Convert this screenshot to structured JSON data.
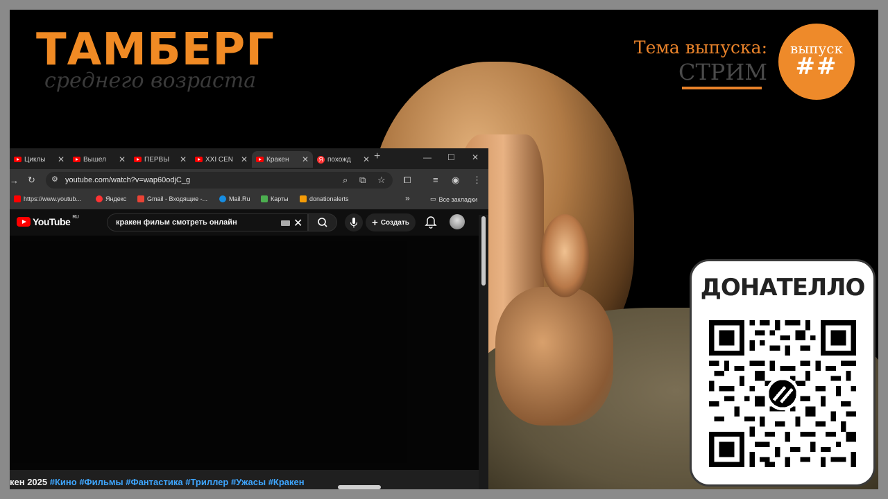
{
  "overlay": {
    "brand_title": "ТАМБЕРГ",
    "brand_subtitle": "среднего возраста",
    "topic_label": "Тема выпуска:",
    "topic_value": "СТРИМ",
    "issue_label": "выпуск",
    "issue_number": "##",
    "donate_title": "ДОНАТЕЛЛО",
    "accent_color": "#f08a24"
  },
  "browser": {
    "tabs": [
      {
        "label": "Циклы",
        "icon": "youtube-icon"
      },
      {
        "label": "Вышел",
        "icon": "youtube-icon"
      },
      {
        "label": "ПЕРВЫ",
        "icon": "youtube-icon"
      },
      {
        "label": "XXI CEN",
        "icon": "youtube-icon"
      },
      {
        "label": "Кракен",
        "icon": "youtube-icon",
        "active": true
      },
      {
        "label": "похожд",
        "icon": "yandex-icon"
      }
    ],
    "url": "youtube.com/watch?v=wap60odjC_g",
    "bookmarks": [
      {
        "label": "https://www.youtub...",
        "icon": "youtube-icon"
      },
      {
        "label": "Яндекс",
        "icon": "yandex-icon"
      },
      {
        "label": "Gmail - Входящие -...",
        "icon": "gmail-icon"
      },
      {
        "label": "Mail.Ru",
        "icon": "mailru-icon"
      },
      {
        "label": "Карты",
        "icon": "maps-icon"
      },
      {
        "label": "donationalerts",
        "icon": "donationalerts-icon"
      }
    ],
    "all_bookmarks": "Все закладки"
  },
  "youtube": {
    "logo_text": "YouTube",
    "region": "RU",
    "search_value": "кракен фильм смотреть онлайн",
    "create_label": "Создать",
    "title_prefix": "кен 2025",
    "hashtags": [
      "#Кино",
      "#Фильмы",
      "#Фантастика",
      "#Триллер",
      "#Ужасы",
      "#Кракен"
    ]
  }
}
